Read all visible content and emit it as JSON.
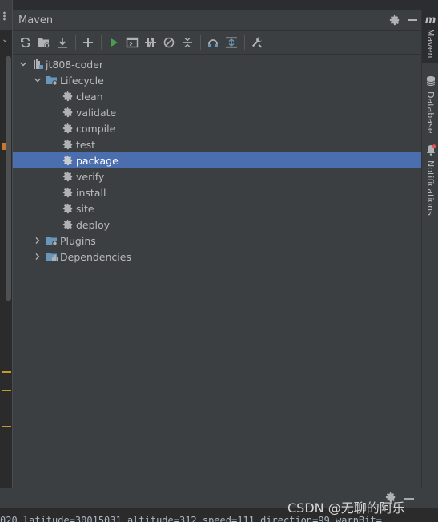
{
  "panel": {
    "title": "Maven"
  },
  "toolbar": {
    "buttons": [
      "reload-icon",
      "add-maven-project-icon",
      "download-icon",
      "add-icon",
      "run-icon",
      "execute-goal-icon",
      "toggle-offline-icon",
      "skip-tests-icon",
      "collapse-all-icon",
      "show-dependencies-icon",
      "expand-icon",
      "settings-wrench-icon"
    ]
  },
  "tree": {
    "project": "jt808-coder",
    "lifecycle": "Lifecycle",
    "goals": [
      "clean",
      "validate",
      "compile",
      "test",
      "package",
      "verify",
      "install",
      "site",
      "deploy"
    ],
    "selected_goal": "package",
    "plugins": "Plugins",
    "dependencies": "Dependencies"
  },
  "right_tabs": {
    "maven_letter": "m",
    "maven": "Maven",
    "database": "Database",
    "notifications": "Notifications"
  },
  "console": {
    "text": "020 latitude=30015031 altitude=312 speed=111 direction=99 warnBit="
  },
  "watermark": "CSDN @无聊的阿乐",
  "colors": {
    "panel_bg": "#3c3f41",
    "selection": "#4b6eaf",
    "run_green": "#499c54",
    "gear_gray": "#afb1b3",
    "folder_blue": "#6897bb"
  }
}
